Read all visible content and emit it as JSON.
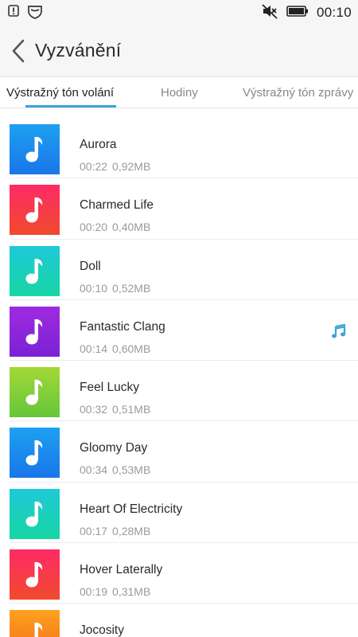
{
  "status": {
    "time": "00:10",
    "left_icons": [
      "alert-icon",
      "shield-icon"
    ],
    "right_icons": [
      "muted-speaker-icon",
      "battery-icon"
    ]
  },
  "header": {
    "title": "Vyzvánění",
    "back_icon": "chevron-left-icon"
  },
  "tabs": [
    {
      "label": "Výstražný tón volání",
      "active": true
    },
    {
      "label": "Hodiny",
      "active": false
    },
    {
      "label": "Výstražný tón zprávy",
      "active": false
    }
  ],
  "colors": {
    "accent": "#3aa6dc"
  },
  "ringtones": [
    {
      "name": "Aurora",
      "duration": "00:22",
      "size": "0,92MB",
      "color_top": "#1ea0f2",
      "color_bottom": "#1976e8",
      "playing": false
    },
    {
      "name": "Charmed Life",
      "duration": "00:20",
      "size": "0,40MB",
      "color_top": "#ff2a66",
      "color_bottom": "#f04a2c",
      "playing": false
    },
    {
      "name": "Doll",
      "duration": "00:10",
      "size": "0,52MB",
      "color_top": "#1ec9d8",
      "color_bottom": "#17d6a3",
      "playing": false
    },
    {
      "name": "Fantastic Clang",
      "duration": "00:14",
      "size": "0,60MB",
      "color_top": "#a02ae0",
      "color_bottom": "#7a22d6",
      "playing": true
    },
    {
      "name": "Feel Lucky",
      "duration": "00:32",
      "size": "0,51MB",
      "color_top": "#a3d838",
      "color_bottom": "#66c63a",
      "playing": false
    },
    {
      "name": "Gloomy Day",
      "duration": "00:34",
      "size": "0,53MB",
      "color_top": "#1ea0f2",
      "color_bottom": "#1976e8",
      "playing": false
    },
    {
      "name": "Heart Of Electricity",
      "duration": "00:17",
      "size": "0,28MB",
      "color_top": "#1ec9d8",
      "color_bottom": "#17d6a3",
      "playing": false
    },
    {
      "name": "Hover Laterally",
      "duration": "00:19",
      "size": "0,31MB",
      "color_top": "#ff2a66",
      "color_bottom": "#f04a2c",
      "playing": false
    },
    {
      "name": "Jocosity",
      "duration": "",
      "size": "",
      "color_top": "#ffa21e",
      "color_bottom": "#f06a1c",
      "playing": false
    }
  ]
}
